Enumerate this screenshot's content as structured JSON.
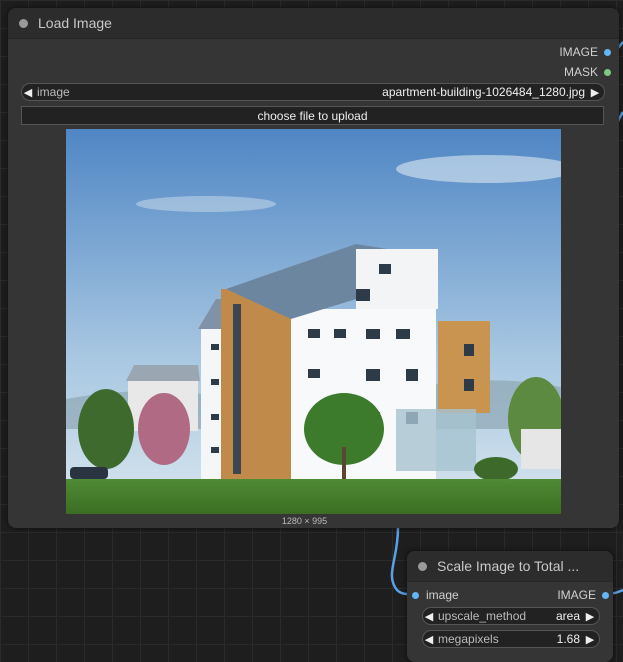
{
  "load_image_node": {
    "title": "Load Image",
    "outputs": [
      {
        "label": "IMAGE",
        "color": "#64b5f6"
      },
      {
        "label": "MASK",
        "color": "#81c784"
      }
    ],
    "image_widget": {
      "label": "image",
      "value": "apartment-building-1026484_1280.jpg"
    },
    "upload_button": "choose file to upload",
    "preview_dimensions": "1280 × 995"
  },
  "scale_node": {
    "title": "Scale Image to Total ...",
    "input": {
      "label": "image",
      "color": "#64b5f6"
    },
    "output": {
      "label": "IMAGE",
      "color": "#64b5f6"
    },
    "widgets": [
      {
        "label": "upscale_method",
        "value": "area"
      },
      {
        "label": "megapixels",
        "value": "1.68"
      }
    ]
  },
  "colors": {
    "wire": "#5aa0e6",
    "canvas": "#1e1e1e",
    "node_body": "#353535",
    "node_title": "#2c2c2c"
  }
}
